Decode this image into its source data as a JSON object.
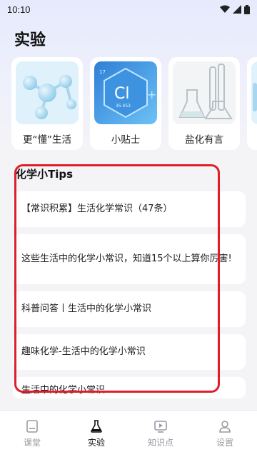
{
  "status": {
    "time": "10:10"
  },
  "header": {
    "title": "实验"
  },
  "cards": [
    {
      "label": "更“懂”生活",
      "icon": "molecule-model-image"
    },
    {
      "label": "小贴士",
      "icon": "chlorine-element-image",
      "symbol": "Cl",
      "number": "17",
      "mass": "35.453"
    },
    {
      "label": "盐化有言",
      "icon": "lab-flasks-image"
    }
  ],
  "section": {
    "title": "化学小Tips"
  },
  "list": [
    {
      "title": "【常识积累】生活化学常识（47条）"
    },
    {
      "title": "这些生活中的化学小常识，知道15个以上算你厉害!"
    },
    {
      "title": "科普问答丨生活中的化学小常识"
    },
    {
      "title": "趣味化学-生活中的化学小常识"
    },
    {
      "title": "生活中的化学小常识"
    }
  ],
  "nav": [
    {
      "label": "课堂",
      "icon": "book-icon"
    },
    {
      "label": "实验",
      "icon": "flask-icon"
    },
    {
      "label": "知识点",
      "icon": "video-play-icon"
    },
    {
      "label": "设置",
      "icon": "user-icon"
    }
  ],
  "colors": {
    "accent": "#e01e2a",
    "card_blue": "#3f9de8"
  }
}
